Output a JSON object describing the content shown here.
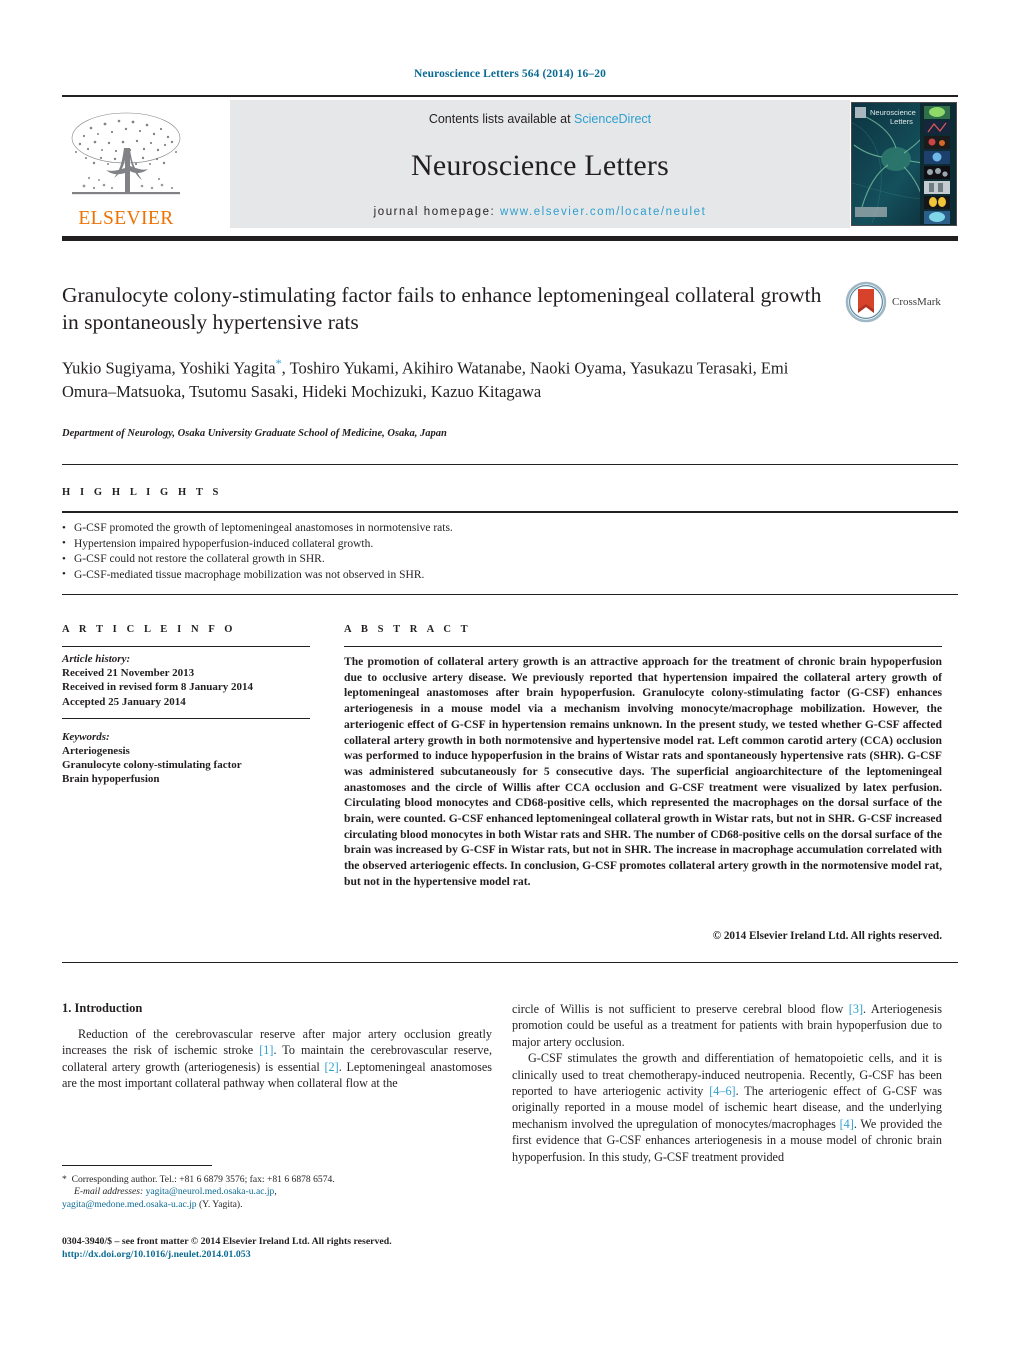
{
  "running_head": "Neuroscience Letters 564 (2014) 16–20",
  "masthead": {
    "publisher_name": "ELSEVIER",
    "contents_prefix": "Contents lists available at ",
    "contents_link": "ScienceDirect",
    "journal_title": "Neuroscience Letters",
    "homepage_prefix": "journal homepage: ",
    "homepage_url": "www.elsevier.com/locate/neulet",
    "cover_title_line1": "Neuroscience",
    "cover_title_line2": "Letters",
    "colors": {
      "link_blue": "#2e9fd0",
      "elsevier_orange": "#ee7203",
      "band_grey": "#e6e7e8",
      "running_head_blue": "#0b6a94"
    }
  },
  "crossmark": {
    "label": "CrossMark"
  },
  "article": {
    "title": "Granulocyte colony-stimulating factor fails to enhance leptomeningeal collateral growth in spontaneously hypertensive rats",
    "authors": "Yukio Sugiyama, Yoshiki Yagita*, Toshiro Yukami, Akihiro Watanabe, Naoki Oyama, Yasukazu Terasaki, Emi Omura–Matsuoka, Tsutomu Sasaki, Hideki Mochizuki, Kazuo Kitagawa",
    "authors_before_star": "Yukio Sugiyama, Yoshiki Yagita",
    "authors_after_star": ", Toshiro Yukami, Akihiro Watanabe, Naoki Oyama, Yasukazu Terasaki, Emi Omura–Matsuoka, Tsutomu Sasaki, Hideki Mochizuki, Kazuo Kitagawa",
    "affiliation": "Department of Neurology, Osaka University Graduate School of Medicine, Osaka, Japan"
  },
  "highlights": {
    "label": "H I G H L I G H T S",
    "items": [
      "G-CSF promoted the growth of leptomeningeal anastomoses in normotensive rats.",
      "Hypertension impaired hypoperfusion-induced collateral growth.",
      "G-CSF could not restore the collateral growth in SHR.",
      "G-CSF-mediated tissue macrophage mobilization was not observed in SHR."
    ]
  },
  "article_info": {
    "label": "A R T I C L E    I N F O",
    "history_label": "Article history:",
    "history": [
      "Received 21 November 2013",
      "Received in revised form 8 January 2014",
      "Accepted 25 January 2014"
    ],
    "keywords_label": "Keywords:",
    "keywords": [
      "Arteriogenesis",
      "Granulocyte colony-stimulating factor",
      "Brain hypoperfusion"
    ]
  },
  "abstract": {
    "label": "A B S T R A C T",
    "text": "The promotion of collateral artery growth is an attractive approach for the treatment of chronic brain hypoperfusion due to occlusive artery disease. We previously reported that hypertension impaired the collateral artery growth of leptomeningeal anastomoses after brain hypoperfusion. Granulocyte colony-stimulating factor (G-CSF) enhances arteriogenesis in a mouse model via a mechanism involving monocyte/macrophage mobilization. However, the arteriogenic effect of G-CSF in hypertension remains unknown. In the present study, we tested whether G-CSF affected collateral artery growth in both normotensive and hypertensive model rat. Left common carotid artery (CCA) occlusion was performed to induce hypoperfusion in the brains of Wistar rats and spontaneously hypertensive rats (SHR). G-CSF was administered subcutaneously for 5 consecutive days. The superficial angioarchitecture of the leptomeningeal anastomoses and the circle of Willis after CCA occlusion and G-CSF treatment were visualized by latex perfusion. Circulating blood monocytes and CD68-positive cells, which represented the macrophages on the dorsal surface of the brain, were counted. G-CSF enhanced leptomeningeal collateral growth in Wistar rats, but not in SHR. G-CSF increased circulating blood monocytes in both Wistar rats and SHR. The number of CD68-positive cells on the dorsal surface of the brain was increased by G-CSF in Wistar rats, but not in SHR. The increase in macrophage accumulation correlated with the observed arteriogenic effects. In conclusion, G-CSF promotes collateral artery growth in the normotensive model rat, but not in the hypertensive model rat.",
    "copyright": "© 2014 Elsevier Ireland Ltd. All rights reserved."
  },
  "body": {
    "section_number_title": "1.  Introduction",
    "left_column": {
      "para1_a": "Reduction of the cerebrovascular reserve after major artery occlusion greatly increases the risk of ischemic stroke ",
      "ref1": "[1]",
      "para1_b": ". To maintain the cerebrovascular reserve, collateral artery growth (arteriogenesis) is essential ",
      "ref2": "[2]",
      "para1_c": ". Leptomeningeal anastomoses are the most important collateral pathway when collateral flow at the"
    },
    "right_column": {
      "cont_a": "circle of Willis is not sufficient to preserve cerebral blood flow ",
      "ref3": "[3]",
      "cont_b": ". Arteriogenesis promotion could be useful as a treatment for patients with brain hypoperfusion due to major artery occlusion.",
      "para2_a": "G-CSF stimulates the growth and differentiation of hematopoietic cells, and it is clinically used to treat chemotherapy-induced neutropenia. Recently, G-CSF has been reported to have arteriogenic activity ",
      "ref46": "[4–6]",
      "para2_b": ". The arteriogenic effect of G-CSF was originally reported in a mouse model of ischemic heart disease, and the underlying mechanism involved the upregulation of monocytes/macrophages ",
      "ref4": "[4]",
      "para2_c": ". We provided the first evidence that G-CSF enhances arteriogenesis in a mouse model of chronic brain hypoperfusion. In this study, G-CSF treatment provided"
    }
  },
  "footnotes": {
    "corresponding_marker": "*",
    "corresponding": "Corresponding author. Tel.: +81 6 6879 3576; fax: +81 6 6878 6574.",
    "email_label": "E-mail addresses:",
    "email1": "yagita@neurol.med.osaka-u.ac.jp",
    "email_sep": ",",
    "email2": "yagita@medone.med.osaka-u.ac.jp",
    "email_attrib": " (Y. Yagita).",
    "issn_line": "0304-3940/$ – see front matter © 2014 Elsevier Ireland Ltd. All rights reserved.",
    "doi": "http://dx.doi.org/10.1016/j.neulet.2014.01.053"
  }
}
